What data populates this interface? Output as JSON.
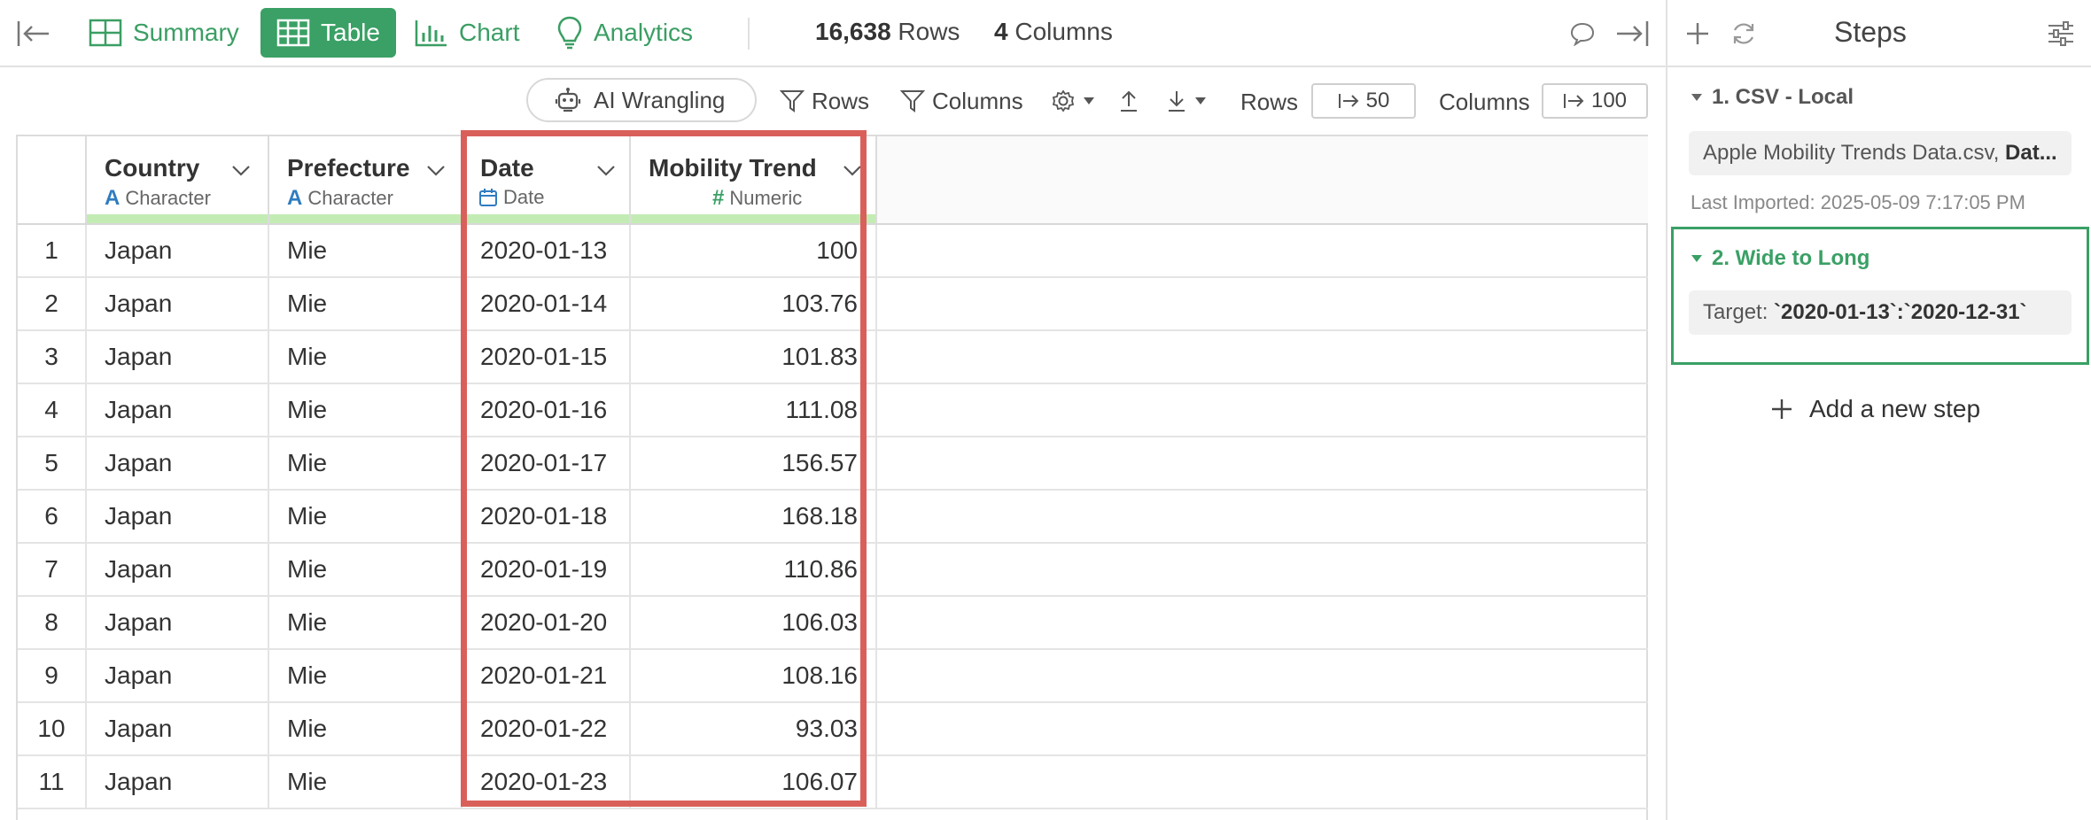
{
  "toolbar_top": {
    "tabs": [
      {
        "label": "Summary",
        "icon": "summary-icon",
        "active": false
      },
      {
        "label": "Table",
        "icon": "table-icon",
        "active": true
      },
      {
        "label": "Chart",
        "icon": "chart-icon",
        "active": false
      },
      {
        "label": "Analytics",
        "icon": "lightbulb-icon",
        "active": false
      }
    ],
    "rows_count": "16,638",
    "rows_label": "Rows",
    "cols_count": "4",
    "cols_label": "Columns"
  },
  "toolbar": {
    "ai_label": "AI Wrangling",
    "rows_filter": "Rows",
    "columns_filter": "Columns",
    "rows_label": "Rows",
    "rows_value": "50",
    "columns_label": "Columns",
    "columns_value": "100"
  },
  "table": {
    "columns": [
      {
        "name": "Country",
        "type": "Character"
      },
      {
        "name": "Prefecture",
        "type": "Character"
      },
      {
        "name": "Date",
        "type": "Date"
      },
      {
        "name": "Mobility Trend",
        "type": "Numeric"
      }
    ],
    "rows": [
      {
        "n": "1",
        "country": "Japan",
        "prefecture": "Mie",
        "date": "2020-01-13",
        "trend": "100"
      },
      {
        "n": "2",
        "country": "Japan",
        "prefecture": "Mie",
        "date": "2020-01-14",
        "trend": "103.76"
      },
      {
        "n": "3",
        "country": "Japan",
        "prefecture": "Mie",
        "date": "2020-01-15",
        "trend": "101.83"
      },
      {
        "n": "4",
        "country": "Japan",
        "prefecture": "Mie",
        "date": "2020-01-16",
        "trend": "111.08"
      },
      {
        "n": "5",
        "country": "Japan",
        "prefecture": "Mie",
        "date": "2020-01-17",
        "trend": "156.57"
      },
      {
        "n": "6",
        "country": "Japan",
        "prefecture": "Mie",
        "date": "2020-01-18",
        "trend": "168.18"
      },
      {
        "n": "7",
        "country": "Japan",
        "prefecture": "Mie",
        "date": "2020-01-19",
        "trend": "110.86"
      },
      {
        "n": "8",
        "country": "Japan",
        "prefecture": "Mie",
        "date": "2020-01-20",
        "trend": "106.03"
      },
      {
        "n": "9",
        "country": "Japan",
        "prefecture": "Mie",
        "date": "2020-01-21",
        "trend": "108.16"
      },
      {
        "n": "10",
        "country": "Japan",
        "prefecture": "Mie",
        "date": "2020-01-22",
        "trend": "93.03"
      },
      {
        "n": "11",
        "country": "Japan",
        "prefecture": "Mie",
        "date": "2020-01-23",
        "trend": "106.07"
      }
    ]
  },
  "steps": {
    "title": "Steps",
    "step1": {
      "title": "1. CSV - Local",
      "file": "Apple Mobility Trends Data.csv,",
      "file_bold": "Dat...",
      "last_imported": "Last Imported: 2025-05-09 7:17:05 PM"
    },
    "step2": {
      "title": "2. Wide to Long",
      "target_label": "Target:",
      "target_value": "`2020-01-13`:`2020-12-31`"
    },
    "add_label": "Add a new step"
  },
  "colors": {
    "accent_green": "#3aa065",
    "highlight_red": "#d9605a",
    "type_blue": "#2f7cc0"
  }
}
